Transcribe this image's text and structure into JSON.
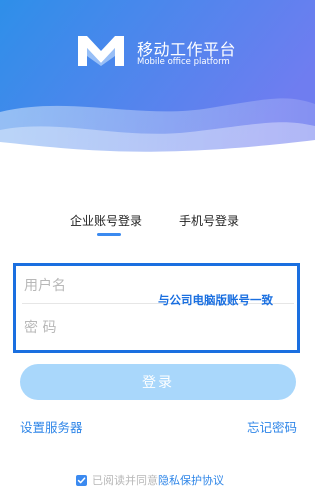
{
  "header": {
    "app_title": "移动工作平台",
    "app_subtitle": "Mobile office platform",
    "logo_icon": "m-logo-icon",
    "gradient_colors": [
      "#2e8fe9",
      "#6f7df0"
    ]
  },
  "tabs": [
    {
      "label": "企业账号登录",
      "active": true
    },
    {
      "label": "手机号登录",
      "active": false
    }
  ],
  "form": {
    "username_placeholder": "用户名",
    "password_placeholder": "密 码",
    "hint": "与公司电脑版账号一致",
    "highlight_color": "#1a6fe0"
  },
  "login_button": {
    "label": "登录",
    "color": "#a9d7fb"
  },
  "links": {
    "server_settings": "设置服务器",
    "forgot_password": "忘记密码"
  },
  "agreement": {
    "checked": true,
    "text": "已阅读并同意",
    "link": "隐私保护协议"
  }
}
